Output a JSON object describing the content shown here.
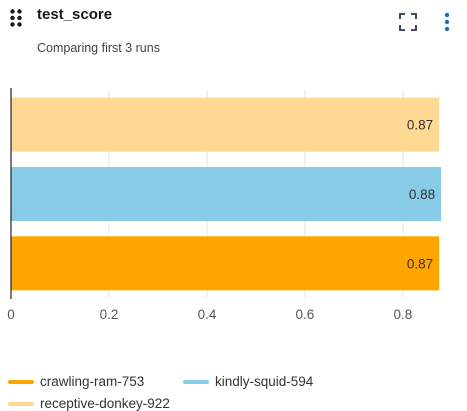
{
  "panel": {
    "title": "test_score",
    "subtitle": "Comparing first 3 runs"
  },
  "icons": {
    "drag": "drag-handle-icon",
    "expand": "fullscreen-icon",
    "menu": "more-vertical-icon"
  },
  "legend": [
    {
      "label": "crawling-ram-753",
      "color": "#FFA500"
    },
    {
      "label": "kindly-squid-594",
      "color": "#87CBE6"
    },
    {
      "label": "receptive-donkey-922",
      "color": "#FFD993"
    }
  ],
  "chart_data": {
    "type": "bar",
    "orientation": "horizontal",
    "title": "",
    "xlabel": "",
    "ylabel": "",
    "xlim": [
      0,
      0.89
    ],
    "xticks": [
      "0",
      "0.2",
      "0.4",
      "0.6",
      "0.8"
    ],
    "tick_values": [
      0,
      0.2,
      0.4,
      0.6,
      0.8
    ],
    "grid": true,
    "legend_position": "bottom",
    "bars": [
      {
        "name": "receptive-donkey-922",
        "value": 0.874,
        "label": "0.87",
        "color": "#FFD993"
      },
      {
        "name": "kindly-squid-594",
        "value": 0.878,
        "label": "0.88",
        "color": "#87CBE6"
      },
      {
        "name": "crawling-ram-753",
        "value": 0.874,
        "label": "0.87",
        "color": "#FFA500"
      }
    ]
  }
}
